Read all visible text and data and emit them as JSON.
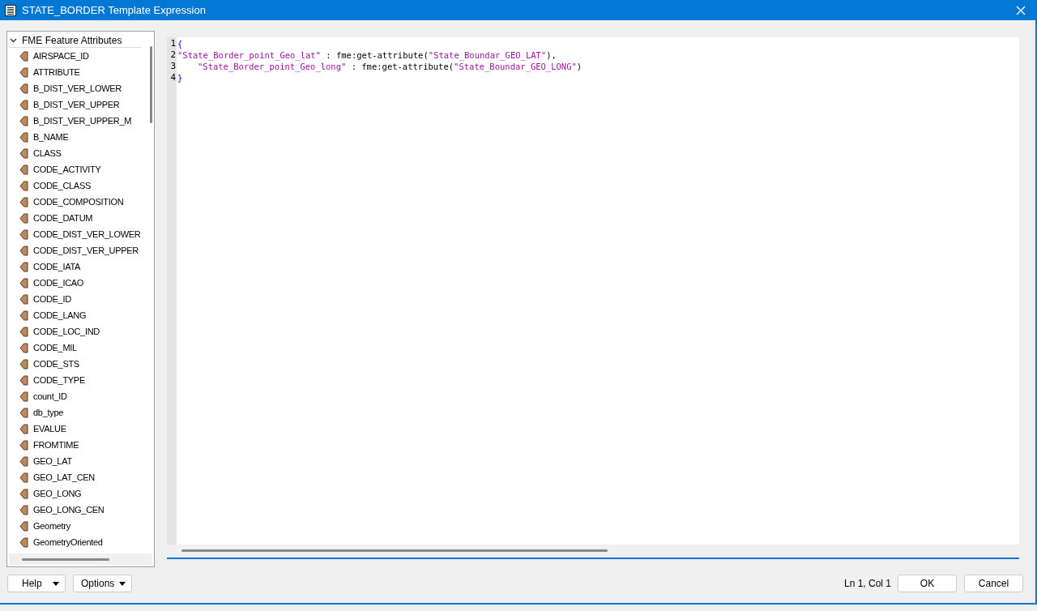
{
  "window": {
    "title": "STATE_BORDER Template Expression"
  },
  "tree": {
    "label": "FME Feature Attributes",
    "expanded": true,
    "children": [
      {
        "label": "AIRSPACE_ID"
      },
      {
        "label": "ATTRIBUTE"
      },
      {
        "label": "B_DIST_VER_LOWER"
      },
      {
        "label": "B_DIST_VER_UPPER"
      },
      {
        "label": "B_DIST_VER_UPPER_M"
      },
      {
        "label": "B_NAME"
      },
      {
        "label": "CLASS"
      },
      {
        "label": "CODE_ACTIVITY"
      },
      {
        "label": "CODE_CLASS"
      },
      {
        "label": "CODE_COMPOSITION"
      },
      {
        "label": "CODE_DATUM"
      },
      {
        "label": "CODE_DIST_VER_LOWER"
      },
      {
        "label": "CODE_DIST_VER_UPPER"
      },
      {
        "label": "CODE_IATA"
      },
      {
        "label": "CODE_ICAO"
      },
      {
        "label": "CODE_ID"
      },
      {
        "label": "CODE_LANG"
      },
      {
        "label": "CODE_LOC_IND"
      },
      {
        "label": "CODE_MIL"
      },
      {
        "label": "CODE_STS"
      },
      {
        "label": "CODE_TYPE"
      },
      {
        "label": "count_ID"
      },
      {
        "label": "db_type"
      },
      {
        "label": "EVALUE"
      },
      {
        "label": "FROMTIME"
      },
      {
        "label": "GEO_LAT"
      },
      {
        "label": "GEO_LAT_CEN"
      },
      {
        "label": "GEO_LONG"
      },
      {
        "label": "GEO_LONG_CEN"
      },
      {
        "label": "Geometry"
      },
      {
        "label": "GeometryOriented"
      }
    ]
  },
  "editor": {
    "lines": [
      {
        "number": "1",
        "tokens": [
          {
            "kind": "brace",
            "text": "{"
          }
        ]
      },
      {
        "number": "2",
        "tokens": [
          {
            "kind": "string",
            "text": "\"State_Border_point_Geo_lat\""
          },
          {
            "kind": "plain",
            "text": " : fme:get-attribute("
          },
          {
            "kind": "string",
            "text": "\"State_Boundar_GEO_LAT\""
          },
          {
            "kind": "plain",
            "text": "),"
          }
        ]
      },
      {
        "number": "3",
        "indent": true,
        "tokens": [
          {
            "kind": "string",
            "text": "\"State_Border_point_Geo_long\""
          },
          {
            "kind": "plain",
            "text": " : fme:get-attribute("
          },
          {
            "kind": "string",
            "text": "\"State_Boundar_GEO_LONG\""
          },
          {
            "kind": "plain",
            "text": ")"
          }
        ]
      },
      {
        "number": "4",
        "tokens": [
          {
            "kind": "brace",
            "text": "}"
          }
        ]
      }
    ]
  },
  "footer": {
    "left_buttons": [
      "Help",
      "Options"
    ],
    "cursor_position": "Ln 1, Col 1",
    "right_buttons": [
      "OK",
      "Cancel"
    ]
  }
}
